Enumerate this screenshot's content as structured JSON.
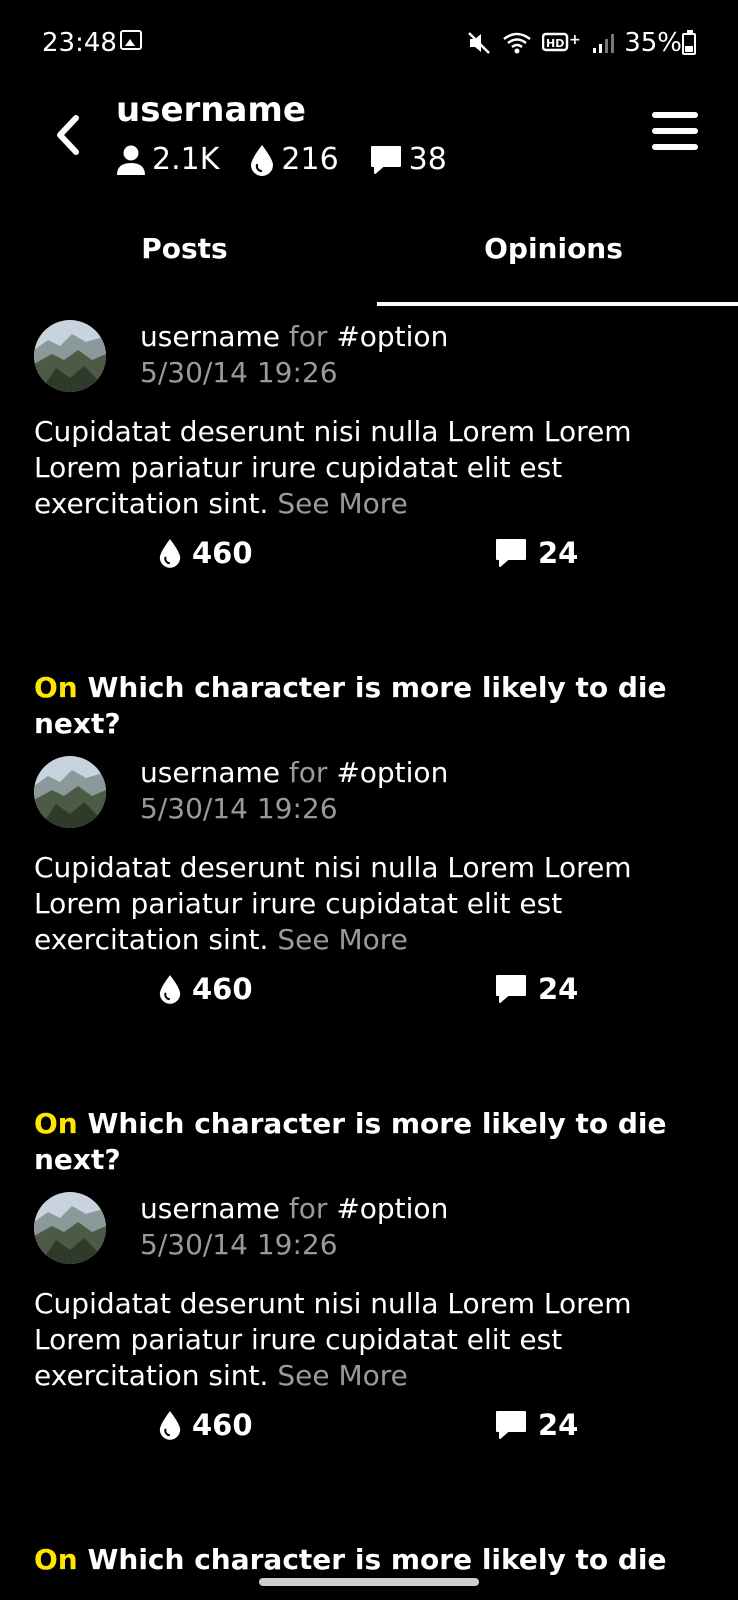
{
  "status_bar": {
    "time": "23:48",
    "battery": "35%",
    "battery_level": 0.35,
    "icons": [
      "image-icon",
      "mute-icon",
      "wifi-icon",
      "hd-icon",
      "signal-icon",
      "battery-icon"
    ]
  },
  "header": {
    "username": "username",
    "followers": "2.1K",
    "drops": "216",
    "comments": "38"
  },
  "tabs": [
    {
      "label": "Posts",
      "active": false
    },
    {
      "label": "Opinions",
      "active": true
    }
  ],
  "colors": {
    "accent": "#ffe600",
    "muted": "#9a9a9a",
    "background": "#000000"
  },
  "feed": [
    {
      "topic_prefix": "",
      "topic": "",
      "author": "username",
      "for_label": "for",
      "option": "#option",
      "date": "5/30/14 19:26",
      "text": "Cupidatat deserunt nisi nulla Lorem Lorem Lorem pariatur irure cupidatat elit est exercitation sint.",
      "see_more": "See More",
      "likes": "460",
      "comments": "24"
    },
    {
      "topic_prefix": "On",
      "topic": "Which character is more likely to die next?",
      "author": "username",
      "for_label": "for",
      "option": "#option",
      "date": "5/30/14 19:26",
      "text": "Cupidatat deserunt nisi nulla Lorem Lorem Lorem pariatur irure cupidatat elit est exercitation sint.",
      "see_more": "See More",
      "likes": "460",
      "comments": "24"
    },
    {
      "topic_prefix": "On",
      "topic": "Which character is more likely to die next?",
      "author": "username",
      "for_label": "for",
      "option": "#option",
      "date": "5/30/14 19:26",
      "text": "Cupidatat deserunt nisi nulla Lorem Lorem Lorem pariatur irure cupidatat elit est exercitation sint.",
      "see_more": "See More",
      "likes": "460",
      "comments": "24"
    },
    {
      "topic_prefix": "On",
      "topic": "Which character is more likely to die"
    }
  ]
}
